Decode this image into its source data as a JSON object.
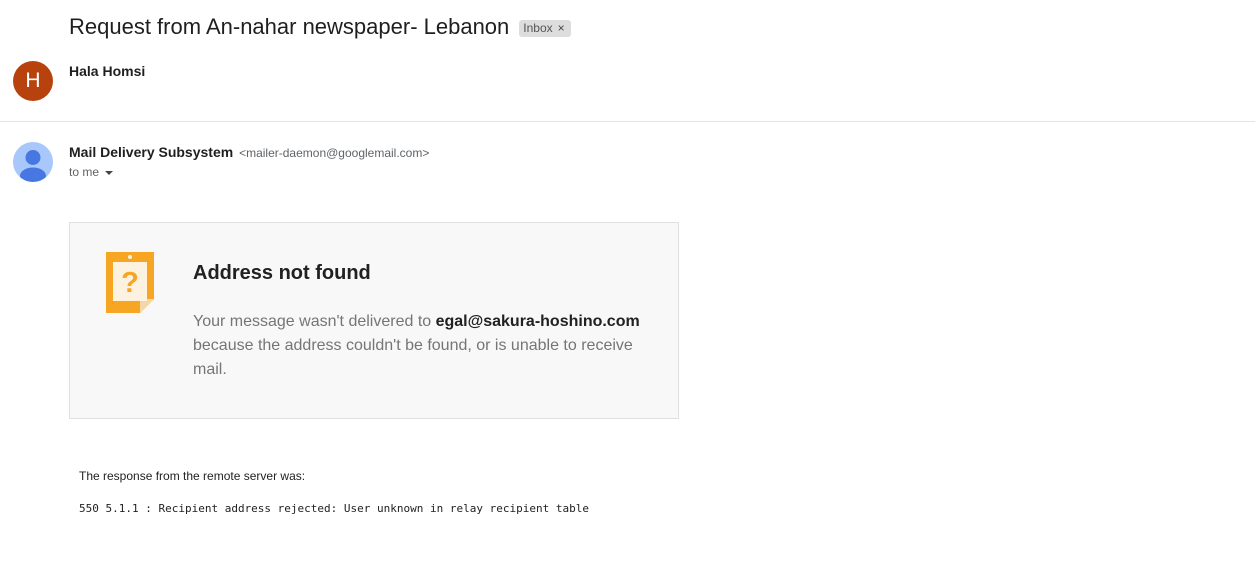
{
  "header": {
    "subject": "Request from An-nahar newspaper- Lebanon",
    "label_chip": "Inbox",
    "label_remove": "×"
  },
  "thread": {
    "collapsed_message": {
      "avatar_letter": "H",
      "avatar_color": "#b8420e",
      "sender_name": "Hala Homsi"
    },
    "open_message": {
      "avatar_icon": "person-icon",
      "avatar_color": "#a8c7fa",
      "sender_name": "Mail Delivery Subsystem",
      "sender_email": "<mailer-daemon@googlemail.com>",
      "recipient_line": "to me"
    }
  },
  "bounce_notice": {
    "icon": "warning-note-icon",
    "icon_color": "#f6a623",
    "title": "Address not found",
    "body_before": "Your message wasn't delivered to ",
    "recipient_address": "egal@sakura-hoshino.com",
    "body_after": " because the address couldn't be found, or is unable to receive mail."
  },
  "server_response": {
    "label": "The response from the remote server was:",
    "code_line": "550 5.1.1 : Recipient address rejected: User unknown in relay recipient table"
  }
}
